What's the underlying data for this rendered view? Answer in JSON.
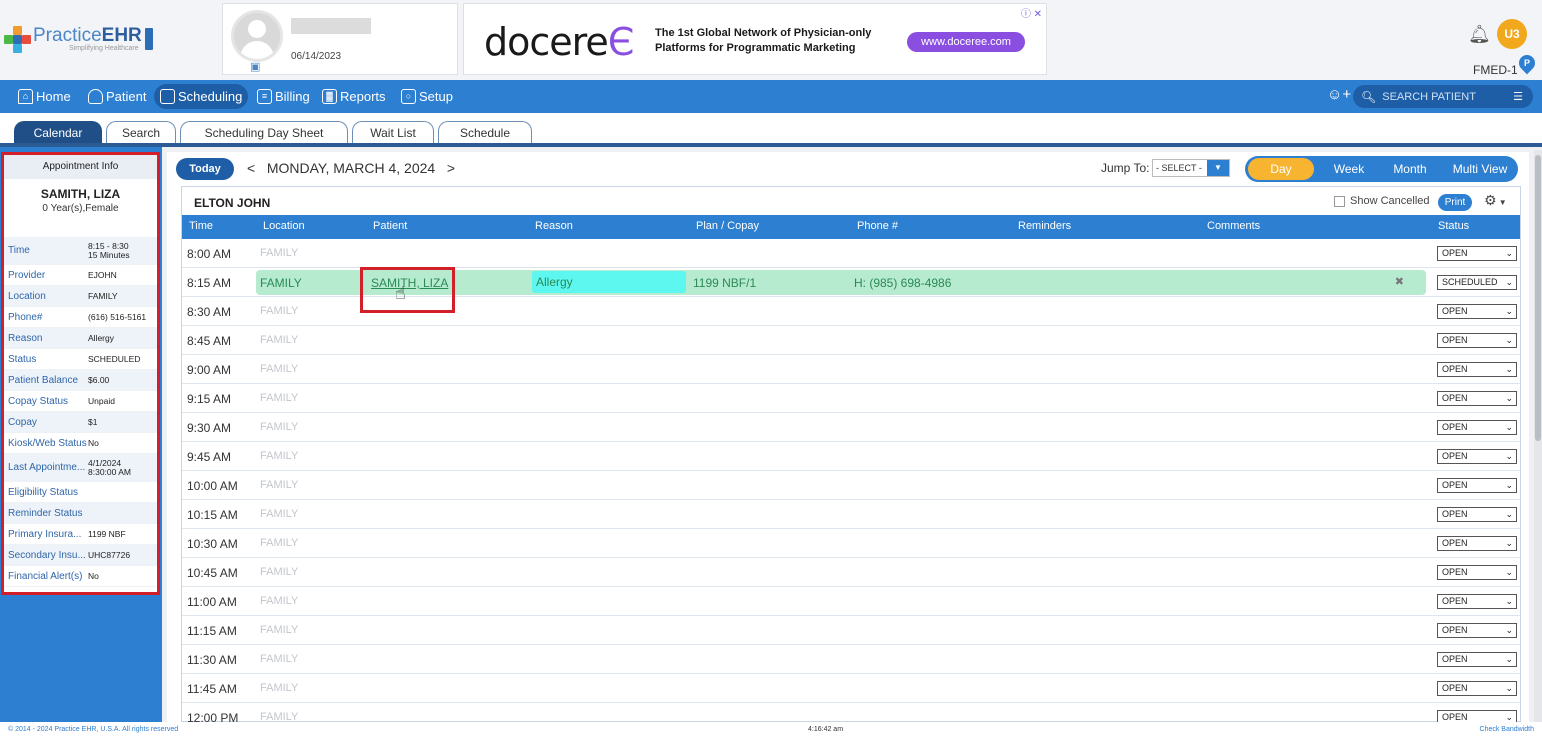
{
  "header": {
    "logo": {
      "text_light": "Practice",
      "text_bold": "EHR",
      "tagline": "Simplifying Healthcare"
    },
    "user": {
      "date": "06/14/2023"
    },
    "ad": {
      "brand": "docere",
      "tagline_line1": "The 1st Global Network of Physician-only",
      "tagline_line2": "Platforms for Programmatic Marketing",
      "button": "www.doceree.com",
      "close": "ⓘ ✕"
    },
    "user_badge": "U3",
    "facility": "FMED-1",
    "pin_letter": "P"
  },
  "nav": {
    "items": [
      {
        "label": "Home",
        "icon": "home-icon"
      },
      {
        "label": "Patient",
        "icon": "patient-icon"
      },
      {
        "label": "Scheduling",
        "icon": "calendar-icon",
        "active": true
      },
      {
        "label": "Billing",
        "icon": "billing-icon"
      },
      {
        "label": "Reports",
        "icon": "reports-icon"
      },
      {
        "label": "Setup",
        "icon": "setup-icon"
      }
    ],
    "search_placeholder": "SEARCH PATIENT"
  },
  "subtabs": [
    "Calendar",
    "Search",
    "Scheduling Day Sheet",
    "Wait List",
    "Schedule"
  ],
  "appointment_info": {
    "header": "Appointment Info",
    "patient_name": "SAMITH, LIZA",
    "patient_meta": "0 Year(s),Female",
    "rows": [
      {
        "label": "Time",
        "value": "8:15 - 8:30\n15 Minutes",
        "tall": true
      },
      {
        "label": "Provider",
        "value": "EJOHN"
      },
      {
        "label": "Location",
        "value": "FAMILY"
      },
      {
        "label": "Phone#",
        "value": "(616) 516-5161"
      },
      {
        "label": "Reason",
        "value": "Allergy"
      },
      {
        "label": "Status",
        "value": "SCHEDULED"
      },
      {
        "label": "Patient Balance",
        "value": "$6.00"
      },
      {
        "label": "Copay Status",
        "value": "Unpaid"
      },
      {
        "label": "Copay",
        "value": "$1"
      },
      {
        "label": "Kiosk/Web Status",
        "value": "No"
      },
      {
        "label": "Last Appointme...",
        "value": "4/1/2024\n8:30:00 AM",
        "tall": true
      },
      {
        "label": "Eligibility Status",
        "value": ""
      },
      {
        "label": "Reminder Status",
        "value": ""
      },
      {
        "label": "Primary Insura...",
        "value": "1199 NBF"
      },
      {
        "label": "Secondary Insu...",
        "value": "UHC87726"
      },
      {
        "label": "Financial Alert(s)",
        "value": "No"
      }
    ]
  },
  "calendar": {
    "today_label": "Today",
    "prev": "<",
    "date": "MONDAY, MARCH 4, 2024",
    "next": ">",
    "jump_label": "Jump To:",
    "jump_value": "- SELECT -",
    "views": [
      "Day",
      "Week",
      "Month",
      "Multi View"
    ],
    "active_view": "Day",
    "provider": "ELTON JOHN",
    "show_cancelled": "Show Cancelled",
    "print": "Print",
    "columns": [
      "Time",
      "Location",
      "Patient",
      "Reason",
      "Plan / Copay",
      "Phone #",
      "Reminders",
      "Comments",
      "Status"
    ],
    "rows": [
      {
        "time": "8:00 AM",
        "location": "FAMILY",
        "status": "OPEN"
      },
      {
        "time": "8:15 AM",
        "location": "FAMILY",
        "status": "SCHEDULED",
        "appointment": {
          "location": "FAMILY",
          "patient": "SAMITH, LIZA",
          "reason": "Allergy",
          "plan": "1199 NBF/1",
          "phone": "H: (985) 698-4986"
        }
      },
      {
        "time": "8:30 AM",
        "location": "FAMILY",
        "status": "OPEN"
      },
      {
        "time": "8:45 AM",
        "location": "FAMILY",
        "status": "OPEN"
      },
      {
        "time": "9:00 AM",
        "location": "FAMILY",
        "status": "OPEN"
      },
      {
        "time": "9:15 AM",
        "location": "FAMILY",
        "status": "OPEN"
      },
      {
        "time": "9:30 AM",
        "location": "FAMILY",
        "status": "OPEN"
      },
      {
        "time": "9:45 AM",
        "location": "FAMILY",
        "status": "OPEN"
      },
      {
        "time": "10:00 AM",
        "location": "FAMILY",
        "status": "OPEN"
      },
      {
        "time": "10:15 AM",
        "location": "FAMILY",
        "status": "OPEN"
      },
      {
        "time": "10:30 AM",
        "location": "FAMILY",
        "status": "OPEN"
      },
      {
        "time": "10:45 AM",
        "location": "FAMILY",
        "status": "OPEN"
      },
      {
        "time": "11:00 AM",
        "location": "FAMILY",
        "status": "OPEN"
      },
      {
        "time": "11:15 AM",
        "location": "FAMILY",
        "status": "OPEN"
      },
      {
        "time": "11:30 AM",
        "location": "FAMILY",
        "status": "OPEN"
      },
      {
        "time": "11:45 AM",
        "location": "FAMILY",
        "status": "OPEN"
      },
      {
        "time": "12:00 PM",
        "location": "FAMILY",
        "status": "OPEN"
      }
    ]
  },
  "footer": {
    "copyright": "© 2014 - 2024 Practice EHR, U.S.A. All rights reserved",
    "clock": "4:16:42 am",
    "bandwidth": "Check Bandwidth"
  },
  "colors": {
    "primary": "#2d7fd1",
    "dark": "#1f4f86",
    "highlight": "#d21f2a",
    "appt": "#b6ebd0",
    "reason": "#5ef7f0",
    "view_active": "#f7b431"
  }
}
